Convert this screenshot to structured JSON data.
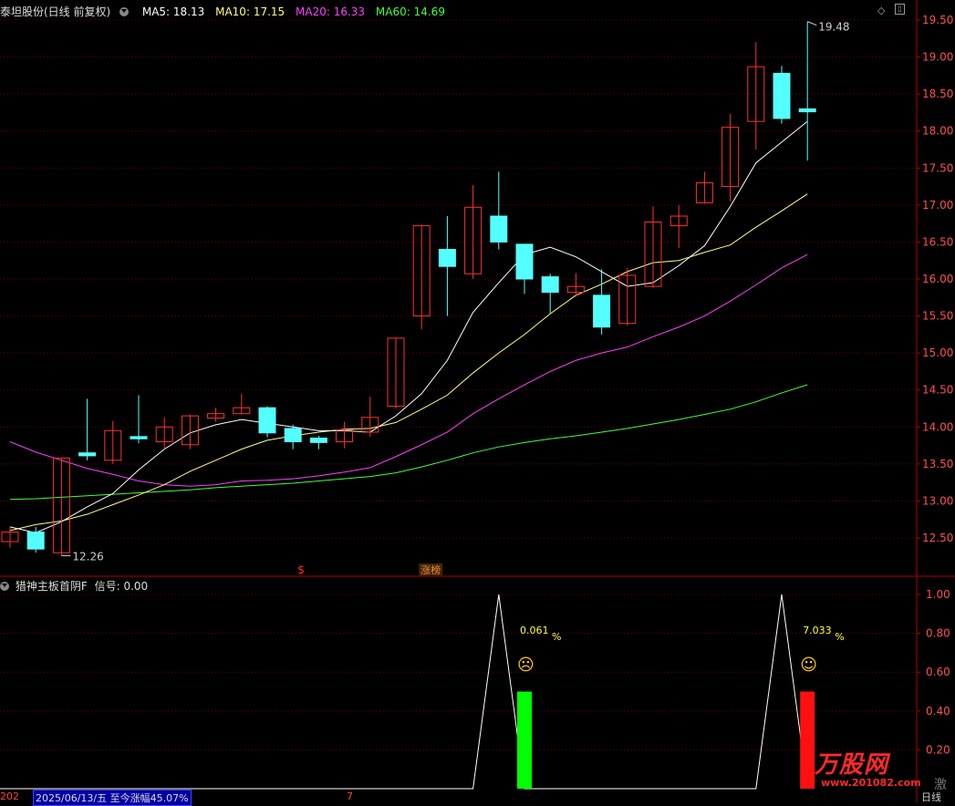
{
  "header": {
    "stock_name": "泰坦股份(日线 前复权)",
    "ma": [
      {
        "label": "MA5:",
        "value": "18.13",
        "color": "#ffffff"
      },
      {
        "label": "MA10:",
        "value": "17.15",
        "color": "#ffff80"
      },
      {
        "label": "MA20:",
        "value": "16.33",
        "color": "#ff40ff"
      },
      {
        "label": "MA60:",
        "value": "14.69",
        "color": "#40ff40"
      }
    ]
  },
  "indicator": {
    "title": "猎神主板首阴F",
    "signal_label": "信号:",
    "signal_value": "0.00",
    "pct_labels": [
      {
        "value": "0.061",
        "unit": "%",
        "face": "☹"
      },
      {
        "value": "7.033",
        "unit": "%",
        "face": "☺"
      }
    ]
  },
  "annotations": {
    "high_label": "19.48",
    "low_label": "12.26",
    "s_marker": "$",
    "zhangbang_marker": "涨榜"
  },
  "statusbar": {
    "left_year": "202",
    "date_info": "2025/06/13/五",
    "gain_info": "至今涨幅45.07%",
    "mid_mark": "7",
    "right_label": "日线"
  },
  "watermark": {
    "brand": "万股网",
    "url": "www.201082.com",
    "side_text": "激"
  },
  "colors": {
    "up": "#ff3030",
    "down": "#54ffff",
    "ma5": "#ffffff",
    "ma10": "#ffff80",
    "ma20": "#ff40ff",
    "ma60": "#40ff40",
    "axis": "#b00000",
    "bar_green": "#00ff00",
    "bar_red": "#ff1010"
  },
  "chart_data": [
    {
      "type": "candlestick",
      "title": "泰坦股份(日线 前复权)",
      "ylim": [
        12.2,
        19.6
      ],
      "y_ticks": [
        "12.50",
        "13.00",
        "13.50",
        "14.00",
        "14.50",
        "15.00",
        "15.50",
        "16.00",
        "16.50",
        "17.00",
        "17.50",
        "18.00",
        "18.50",
        "19.00",
        "19.50"
      ],
      "candles": [
        {
          "o": 12.45,
          "c": 12.58,
          "h": 12.65,
          "l": 12.37
        },
        {
          "o": 12.58,
          "c": 12.35,
          "h": 12.65,
          "l": 12.3
        },
        {
          "o": 12.3,
          "c": 13.58,
          "h": 13.58,
          "l": 12.26
        },
        {
          "o": 13.65,
          "c": 13.61,
          "h": 14.38,
          "l": 13.55
        },
        {
          "o": 13.55,
          "c": 13.95,
          "h": 14.08,
          "l": 13.5
        },
        {
          "o": 13.87,
          "c": 13.84,
          "h": 14.43,
          "l": 13.78
        },
        {
          "o": 13.8,
          "c": 14.0,
          "h": 14.13,
          "l": 13.7
        },
        {
          "o": 13.76,
          "c": 14.15,
          "h": 14.17,
          "l": 13.7
        },
        {
          "o": 14.12,
          "c": 14.18,
          "h": 14.26,
          "l": 14.07
        },
        {
          "o": 14.18,
          "c": 14.26,
          "h": 14.45,
          "l": 14.17
        },
        {
          "o": 14.26,
          "c": 13.92,
          "h": 14.28,
          "l": 13.86
        },
        {
          "o": 13.98,
          "c": 13.8,
          "h": 14.03,
          "l": 13.7
        },
        {
          "o": 13.85,
          "c": 13.79,
          "h": 13.88,
          "l": 13.7
        },
        {
          "o": 13.8,
          "c": 13.96,
          "h": 14.07,
          "l": 13.71
        },
        {
          "o": 13.93,
          "c": 14.13,
          "h": 14.41,
          "l": 13.87
        },
        {
          "o": 14.28,
          "c": 15.2,
          "h": 15.2,
          "l": 14.25
        },
        {
          "o": 15.5,
          "c": 16.72,
          "h": 16.72,
          "l": 15.32
        },
        {
          "o": 16.4,
          "c": 16.17,
          "h": 16.85,
          "l": 15.5
        },
        {
          "o": 16.07,
          "c": 16.97,
          "h": 17.27,
          "l": 16.0
        },
        {
          "o": 16.85,
          "c": 16.5,
          "h": 17.45,
          "l": 16.4
        },
        {
          "o": 16.47,
          "c": 16.0,
          "h": 16.47,
          "l": 15.8
        },
        {
          "o": 16.03,
          "c": 15.82,
          "h": 16.07,
          "l": 15.53
        },
        {
          "o": 15.82,
          "c": 15.9,
          "h": 16.08,
          "l": 15.76
        },
        {
          "o": 15.78,
          "c": 15.35,
          "h": 16.13,
          "l": 15.25
        },
        {
          "o": 15.4,
          "c": 16.05,
          "h": 16.15,
          "l": 15.37
        },
        {
          "o": 15.9,
          "c": 16.77,
          "h": 16.98,
          "l": 15.88
        },
        {
          "o": 16.72,
          "c": 16.85,
          "h": 17.0,
          "l": 16.42
        },
        {
          "o": 17.03,
          "c": 17.3,
          "h": 17.45,
          "l": 17.02
        },
        {
          "o": 17.25,
          "c": 18.05,
          "h": 18.23,
          "l": 17.05
        },
        {
          "o": 18.13,
          "c": 18.87,
          "h": 19.2,
          "l": 17.75
        },
        {
          "o": 18.78,
          "c": 18.17,
          "h": 18.88,
          "l": 18.1
        },
        {
          "o": 18.3,
          "c": 18.26,
          "h": 19.48,
          "l": 17.6
        }
      ],
      "ma": {
        "ma5": [
          12.65,
          12.57,
          12.72,
          12.92,
          13.1,
          13.42,
          13.7,
          13.92,
          14.03,
          14.1,
          14.05,
          14.0,
          13.95,
          13.95,
          13.93,
          14.15,
          14.45,
          14.9,
          15.55,
          15.95,
          16.33,
          16.43,
          16.3,
          16.1,
          15.9,
          15.95,
          16.18,
          16.45,
          16.98,
          17.57,
          17.85,
          18.13
        ],
        "ma10": [
          12.6,
          12.68,
          12.73,
          12.82,
          12.95,
          13.08,
          13.22,
          13.4,
          13.55,
          13.7,
          13.82,
          13.88,
          13.93,
          13.97,
          13.98,
          14.06,
          14.24,
          14.43,
          14.73,
          15.0,
          15.25,
          15.53,
          15.78,
          15.93,
          16.1,
          16.22,
          16.25,
          16.36,
          16.46,
          16.7,
          16.92,
          17.15
        ],
        "ma20": [
          13.8,
          13.66,
          13.55,
          13.44,
          13.36,
          13.27,
          13.22,
          13.2,
          13.22,
          13.27,
          13.28,
          13.3,
          13.34,
          13.39,
          13.45,
          13.6,
          13.76,
          13.93,
          14.18,
          14.38,
          14.57,
          14.75,
          14.9,
          15.0,
          15.08,
          15.22,
          15.35,
          15.5,
          15.7,
          15.92,
          16.15,
          16.33
        ],
        "ma60": [
          13.02,
          13.03,
          13.05,
          13.07,
          13.09,
          13.11,
          13.13,
          13.15,
          13.18,
          13.2,
          13.22,
          13.24,
          13.27,
          13.3,
          13.33,
          13.38,
          13.46,
          13.55,
          13.65,
          13.73,
          13.79,
          13.84,
          13.88,
          13.93,
          13.98,
          14.04,
          14.1,
          14.17,
          14.24,
          14.34,
          14.46,
          14.57
        ]
      },
      "ma_tail": {
        "ma5": 18.13,
        "ma10": 17.15,
        "ma20": 16.33,
        "ma60": 14.69
      }
    },
    {
      "type": "line",
      "title": "猎神主板首阴F",
      "ylim": [
        0,
        1.05
      ],
      "y_ticks": [
        "1.00",
        "0.80",
        "0.60",
        "0.40",
        "0.20"
      ],
      "signal": [
        0,
        0,
        0,
        0,
        0,
        0,
        0,
        0,
        0,
        0,
        0,
        0,
        0,
        0,
        0,
        0,
        0,
        0,
        0,
        1,
        0,
        0,
        0,
        0,
        0,
        0,
        0,
        0,
        0,
        0,
        1,
        0
      ],
      "bars": [
        {
          "index": 20,
          "value": 0.5,
          "color": "green"
        },
        {
          "index": 31,
          "value": 0.5,
          "color": "red"
        }
      ]
    }
  ]
}
